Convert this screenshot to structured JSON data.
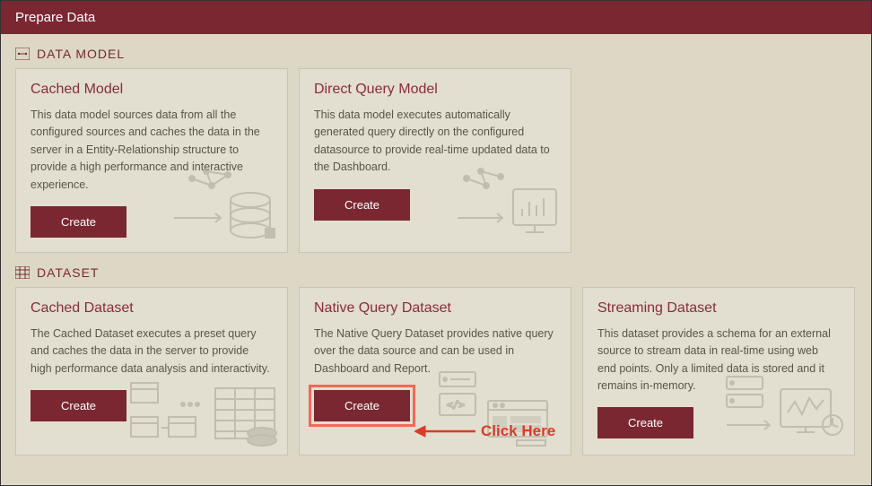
{
  "header": {
    "title": "Prepare Data"
  },
  "sections": {
    "data_model": {
      "label": "DATA MODEL",
      "cards": {
        "cached_model": {
          "title": "Cached Model",
          "desc": "This data model sources data from all the configured sources and caches the data in the server in a Entity-Relationship structure to provide a high performance and interactive experience.",
          "button": "Create"
        },
        "direct_query_model": {
          "title": "Direct Query Model",
          "desc": "This data model executes automatically generated query directly on the configured datasource to provide real-time updated data to the Dashboard.",
          "button": "Create"
        }
      }
    },
    "dataset": {
      "label": "DATASET",
      "cards": {
        "cached_dataset": {
          "title": "Cached Dataset",
          "desc": "The Cached Dataset executes a preset query and caches the data in the server to provide high performance data analysis and interactivity.",
          "button": "Create"
        },
        "native_query_dataset": {
          "title": "Native Query Dataset",
          "desc": "The Native Query Dataset provides native query over the data source and can be used in Dashboard and Report.",
          "button": "Create"
        },
        "streaming_dataset": {
          "title": "Streaming Dataset",
          "desc": "This dataset provides a schema for an external source to stream data in real-time using web end points. Only a limited data is stored and it remains in-memory.",
          "button": "Create"
        }
      }
    }
  },
  "annotation": {
    "text": "Click Here"
  }
}
